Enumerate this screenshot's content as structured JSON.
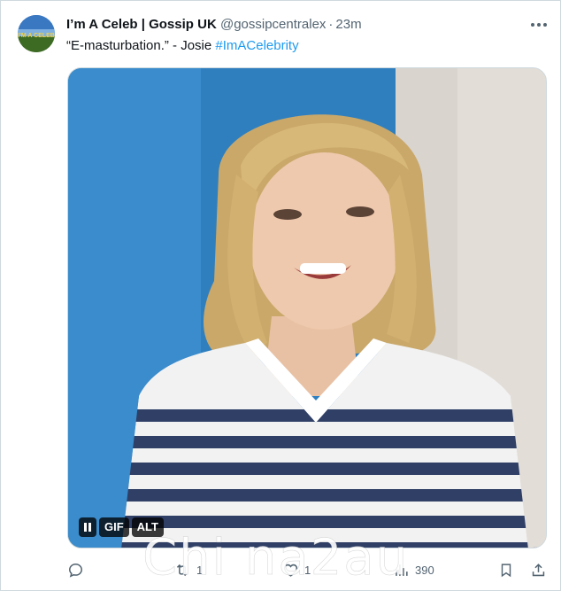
{
  "tweet": {
    "author": {
      "display_name": "I’m A Celeb | Gossip UK",
      "handle": "@gossipcentralex",
      "separator": "·",
      "time": "23m",
      "avatar_text": "I'M A CELEB"
    },
    "text": {
      "quote": "“E-masturbation.” - Josie ",
      "hashtag": "#ImACelebrity"
    },
    "media": {
      "gif_label": "GIF",
      "alt_label": "ALT"
    },
    "actions": {
      "reply_count": "",
      "retweet_count": "1",
      "like_count": "1",
      "views_count": "390"
    },
    "icons": [
      "more-icon",
      "pause-icon",
      "reply-icon",
      "retweet-icon",
      "like-icon",
      "views-icon",
      "bookmark-icon",
      "share-icon"
    ]
  },
  "watermark": "Chi na2au",
  "colors": {
    "link": "#1d9bf0",
    "secondary_text": "#536471",
    "border": "#cfd9de"
  }
}
